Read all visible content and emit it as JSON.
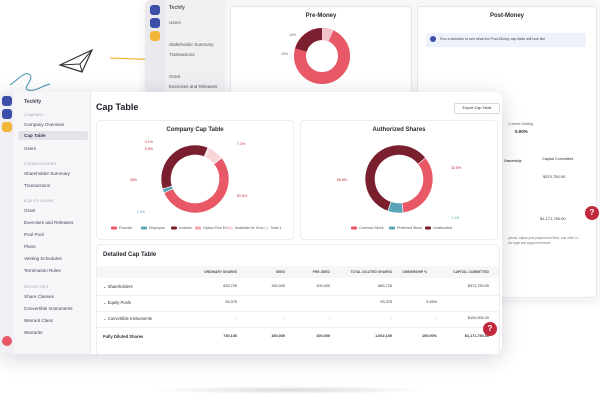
{
  "app": {
    "name": "Techfy"
  },
  "colors": {
    "accent": "#e85866",
    "dark": "#7a1f2e",
    "teal": "#5ba3b8",
    "pink": "#f2c4c9",
    "yellow": "#f2b73a",
    "nav": "#3b4ea8",
    "green": "#5cb85c"
  },
  "background_window": {
    "app_name": "Techfy",
    "items": [
      "Users",
      "Stakeholder Summary",
      "Transactions",
      "Grant",
      "Exercises and Releases"
    ],
    "card_left_title": "Pre-Money",
    "card_left_labels": [
      "10%",
      "10%"
    ],
    "card_right_title": "Post-Money",
    "info_text": "Run a scenario to see what the Post-Money cap table will look like",
    "summary_label": "Current Holding",
    "summary_value": "0.00%",
    "ownership_col": "Ownership",
    "capital_col": "Capital Committed",
    "values": [
      "$370,750.00",
      "$1,171,750.00"
    ],
    "footnote": "...ptions, adjust your payment method, and other in...\n...for legal and support services"
  },
  "sidebar": {
    "company": "Techify",
    "sections": [
      {
        "header": "COMPANY",
        "items": [
          "Company Overview",
          "Cap Table",
          "Users"
        ]
      },
      {
        "header": "STAKEHOLDERS",
        "items": [
          "Shareholder Summary",
          "Transactions"
        ]
      },
      {
        "header": "EQUITY PLANS",
        "items": [
          "Grant",
          "Exercises and Releases",
          "Pool Pool",
          "Plans",
          "Vesting Schedules",
          "Termination Rules"
        ]
      },
      {
        "header": "SECURITIES",
        "items": [
          "Share Classes",
          "Convertible Instruments",
          "Warrant Class",
          "Warrants"
        ]
      }
    ],
    "active_item": "Cap Table"
  },
  "page": {
    "title": "Cap Table",
    "export_label": "Export Cap Table"
  },
  "chart_data": [
    {
      "type": "pie",
      "title": "Company Cap Table",
      "categories": [
        "Founder",
        "Employee",
        "Investor",
        "Option Pool Ext",
        "Available for Grant",
        "Note 1"
      ],
      "values": [
        52.6,
        1.9,
        35.0,
        0.5,
        7.3,
        0.1
      ],
      "colors": [
        "#e85866",
        "#5ba3b8",
        "#7a1f2e",
        "#f2a7b0",
        "#f7d5d9",
        "#e3e6ee"
      ],
      "data_labels": [
        "0.1%",
        "0.5%",
        "7.3%",
        "35%",
        "52.6%",
        "1.9%"
      ],
      "legend": "bottom"
    },
    {
      "type": "pie",
      "title": "Authorized Shares",
      "categories": [
        "Common Stock",
        "Preferred Stock",
        "Unallocated"
      ],
      "values": [
        32.5,
        7.1,
        56.8
      ],
      "colors": [
        "#e85866",
        "#5ba3b8",
        "#7a1f2e"
      ],
      "data_labels": [
        "32.5%",
        "56.8%",
        "7.1%"
      ],
      "legend": "bottom"
    }
  ],
  "table": {
    "title": "Detailed Cap Table",
    "columns": [
      "ORDINARY SHARES",
      "SEED",
      "PRE-SEED",
      "TOTAL DILUTED SHARES",
      "OWNERSHIP %",
      "CAPITAL COMMITTED"
    ],
    "rows": [
      {
        "label": "Shareholders",
        "cells": [
          "633,725",
          "150,000",
          "100,000",
          "883,725",
          "",
          "$371,750.00"
        ]
      },
      {
        "label": "Equity Pools",
        "cells": [
          "93,375",
          "",
          "",
          "93,375",
          "9.45%",
          ""
        ]
      },
      {
        "label": "Convertible Instruments",
        "cells": [
          "-",
          "-",
          "-",
          "-",
          "-",
          "$100,000.00"
        ]
      }
    ],
    "total": {
      "label": "Fully Diluted Shares",
      "cells": [
        "730,100",
        "150,000",
        "100,000",
        "1,002,100",
        "100.00%",
        "$1,171,750.00"
      ]
    }
  }
}
